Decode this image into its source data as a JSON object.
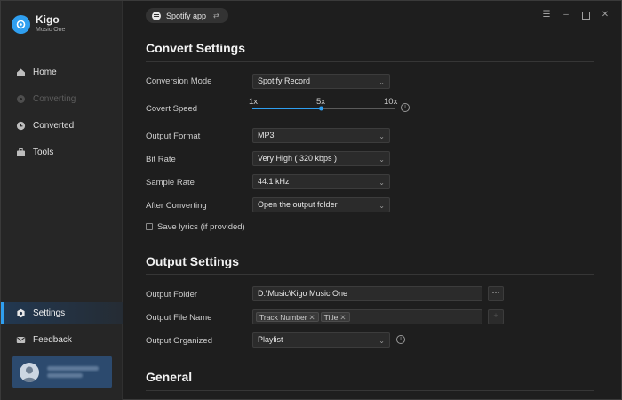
{
  "app": {
    "name": "Kigo",
    "subtitle": "Music One"
  },
  "sidebar": {
    "items": [
      {
        "label": "Home",
        "icon": "home-icon",
        "state": "normal"
      },
      {
        "label": "Converting",
        "icon": "converting-icon",
        "state": "disabled"
      },
      {
        "label": "Converted",
        "icon": "clock-icon",
        "state": "normal"
      },
      {
        "label": "Tools",
        "icon": "toolbox-icon",
        "state": "normal"
      },
      {
        "label": "Settings",
        "icon": "gear-icon",
        "state": "active"
      },
      {
        "label": "Feedback",
        "icon": "mail-icon",
        "state": "normal"
      }
    ]
  },
  "source": {
    "label": "Spotify app",
    "swap_icon": "swap-icon"
  },
  "window_controls": [
    "menu-icon",
    "minimize-icon",
    "maximize-icon",
    "close-icon"
  ],
  "convert": {
    "title": "Convert Settings",
    "mode": {
      "label": "Conversion Mode",
      "value": "Spotify Record"
    },
    "speed": {
      "label": "Covert Speed",
      "ticks": [
        "1x",
        "5x",
        "10x"
      ],
      "value_fraction": 0.5
    },
    "format": {
      "label": "Output Format",
      "value": "MP3"
    },
    "bitrate": {
      "label": "Bit Rate",
      "value": "Very High ( 320 kbps )"
    },
    "samplerate": {
      "label": "Sample Rate",
      "value": "44.1 kHz"
    },
    "after": {
      "label": "After Converting",
      "value": "Open the output folder"
    },
    "lyrics": {
      "label": "Save lyrics (if provided)",
      "checked": false
    }
  },
  "output": {
    "title": "Output Settings",
    "folder": {
      "label": "Output Folder",
      "value": "D:\\Music\\Kigo Music One",
      "button": "···"
    },
    "filename": {
      "label": "Output File Name",
      "tags": [
        "Track Number",
        "Title"
      ],
      "button": "+"
    },
    "organized": {
      "label": "Output Organized",
      "value": "Playlist"
    }
  },
  "general": {
    "title": "General"
  },
  "colors": {
    "accent": "#2f9ff0",
    "background": "#1e1e1e",
    "sidebar": "#262626"
  }
}
